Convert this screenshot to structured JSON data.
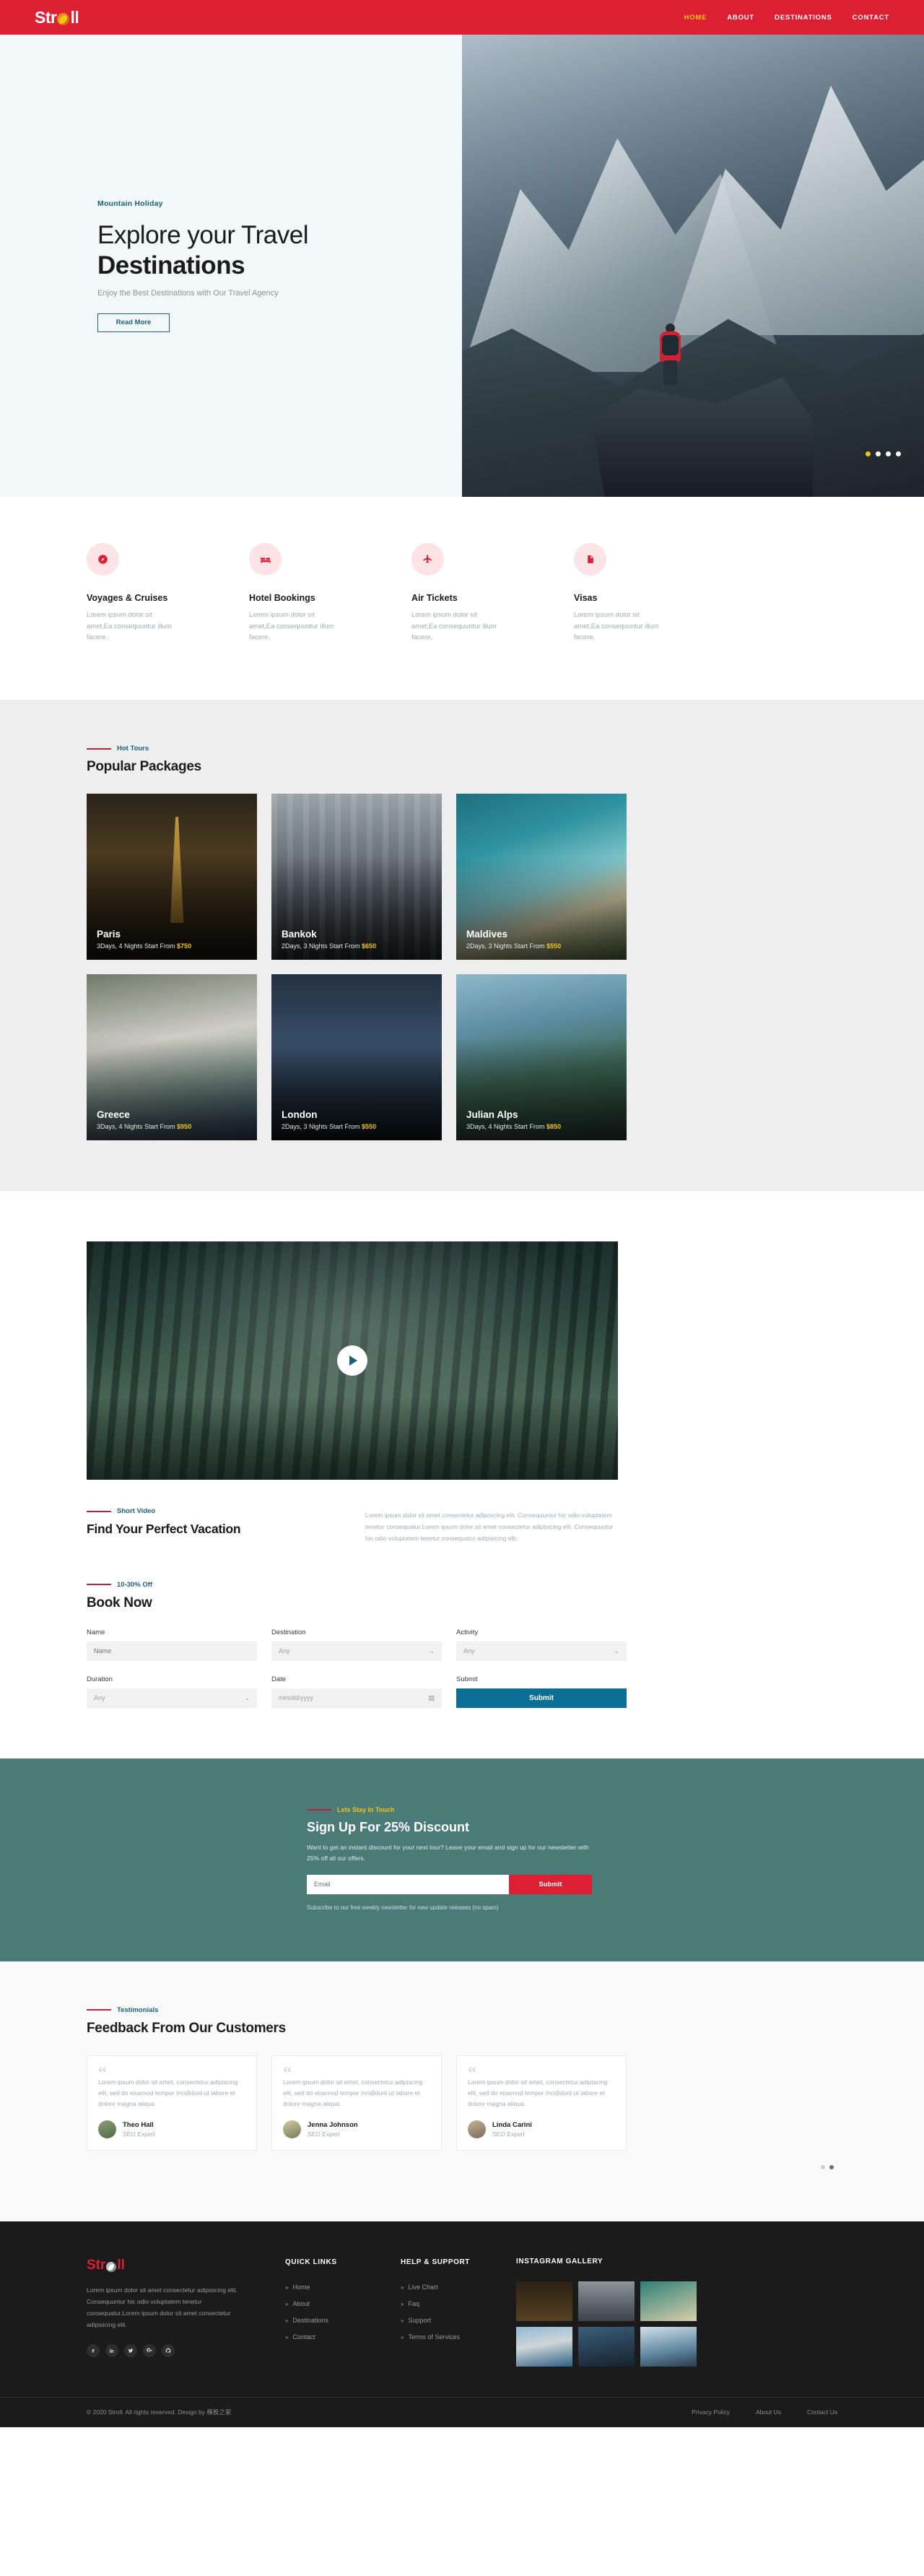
{
  "header": {
    "logo_text_1": "Str",
    "logo_text_2": "ll",
    "nav": [
      {
        "label": "HOME",
        "active": true
      },
      {
        "label": "ABOUT",
        "active": false
      },
      {
        "label": "DESTINATIONS",
        "active": false
      },
      {
        "label": "CONTACT",
        "active": false
      }
    ],
    "accent_color": "#dd1f34",
    "active_nav_color": "#f5c518"
  },
  "hero": {
    "kicker": "Mountain Holiday",
    "title_line1": "Explore your Travel",
    "title_line2": "Destinations",
    "subtitle": "Enjoy the Best Destinations with Our Travel Agency",
    "button": "Read More",
    "slider_dots": 4,
    "active_dot": 1
  },
  "services": [
    {
      "icon": "compass-icon",
      "title": "Voyages & Cruises",
      "desc": "Lorem ipsum dolor sit amet,Ea consequuntur illum facere."
    },
    {
      "icon": "bed-icon",
      "title": "Hotel Bookings",
      "desc": "Lorem ipsum dolor sit amet,Ea consequuntur illum facere."
    },
    {
      "icon": "plane-icon",
      "title": "Air Tickets",
      "desc": "Lorem ipsum dolor sit amet,Ea consequuntur illum facere."
    },
    {
      "icon": "document-icon",
      "title": "Visas",
      "desc": "Lorem ipsum dolor sit amet,Ea consequuntur illum facere."
    }
  ],
  "packages": {
    "kicker": "Hot Tours",
    "title": "Popular Packages",
    "items": [
      {
        "name": "Paris",
        "meta_pre": "3Days, 4 Nights Start From ",
        "price": "$750",
        "img": "img-paris"
      },
      {
        "name": "Bankok",
        "meta_pre": "2Days, 3 Nights Start From ",
        "price": "$650",
        "img": "img-bankok"
      },
      {
        "name": "Maldives",
        "meta_pre": "2Days, 3 Nights Start From ",
        "price": "$550",
        "img": "img-maldives"
      },
      {
        "name": "Greece",
        "meta_pre": "3Days, 4 Nights Start From ",
        "price": "$950",
        "img": "img-greece"
      },
      {
        "name": "London",
        "meta_pre": "2Days, 3 Nights Start From ",
        "price": "$550",
        "img": "img-london"
      },
      {
        "name": "Julian Alps",
        "meta_pre": "3Days, 4 Nights Start From ",
        "price": "$850",
        "img": "img-alps"
      }
    ]
  },
  "vacation": {
    "kicker": "Short Video",
    "title": "Find Your Perfect Vacation",
    "text": "Lorem ipsum dolor sit amet consectetur adipisicing elit. Consequuntur hic odio voluptatem tenetur consequatur.Lorem ipsum dolor sit amet consectetur adipisicing elit. Consequuntur hic odio voluptatem tenetur consequatur adipisicing elit."
  },
  "book": {
    "kicker": "10-30% Off",
    "title": "Book Now",
    "fields": [
      {
        "label": "Name",
        "value": "Name",
        "type": "text"
      },
      {
        "label": "Destination",
        "value": "Any",
        "type": "select"
      },
      {
        "label": "Activity",
        "value": "Any",
        "type": "select"
      },
      {
        "label": "Duration",
        "value": "Any",
        "type": "select"
      },
      {
        "label": "Date",
        "value": "mm/dd/yyyy",
        "type": "date"
      }
    ],
    "submit_label": "Submit",
    "submit_field_label": "Submit",
    "submit_color": "#0d6e95"
  },
  "newsletter": {
    "kicker": "Lets Stay In Touch",
    "title": "Sign Up For 25% Discount",
    "desc": "Want to get an instant discount for your next tour? Leave your email and sign up for our newsletter with 25% off all our offers.",
    "email_placeholder": "Email",
    "submit_label": "Submit",
    "note": "Subscribe to our free weekly newsletter for new update releases (no spam)",
    "bg_color": "#4b7b77"
  },
  "testimonials": {
    "kicker": "Testimonials",
    "title": "Feedback From Our Customers",
    "items": [
      {
        "text": "Lorem ipsum dolor sit amet, consectetur adipiscing elit, sed do eiusmod tempor incididunt ut labore et dolore magna aliqua.",
        "name": "Theo Hall",
        "role": "SEO Expert"
      },
      {
        "text": "Lorem ipsum dolor sit amet, consectetur adipiscing elit, sed do eiusmod tempor incididunt ut labore et dolore magna aliqua.",
        "name": "Jenna Johnson",
        "role": "SEO Expert"
      },
      {
        "text": "Lorem ipsum dolor sit amet, consectetur adipiscing elit, sed do eiusmod tempor incididunt ut labore et dolore magna aliqua.",
        "name": "Linda Carini",
        "role": "SEO Expert"
      }
    ],
    "dots": 2,
    "active_dot": 2
  },
  "footer": {
    "logo_text_1": "Str",
    "logo_text_2": "ll",
    "desc": "Lorem ipsum dolor sit amet consectetur adipisicing elit. Consequuntur hic odio voluptatem tenetur consequatur.Lorem ipsum dolor sit amet consectetur adipisicing elit.",
    "social": [
      "facebook-icon",
      "linkedin-icon",
      "twitter-icon",
      "google-plus-icon",
      "github-icon"
    ],
    "quick_links_title": "QUICK LINKS",
    "quick_links": [
      "Home",
      "About",
      "Destinations",
      "Contact"
    ],
    "help_title": "HELP & SUPPORT",
    "help_links": [
      "Live Chart",
      "Faq",
      "Support",
      "Terms of Services"
    ],
    "instagram_title": "INSTAGRAM GALLERY",
    "copyright": "© 2020 Stroll. All rights reserved. Design by 模板之家",
    "bottom_links": [
      "Privacy Policy",
      "About Us",
      "Contact Us"
    ]
  }
}
